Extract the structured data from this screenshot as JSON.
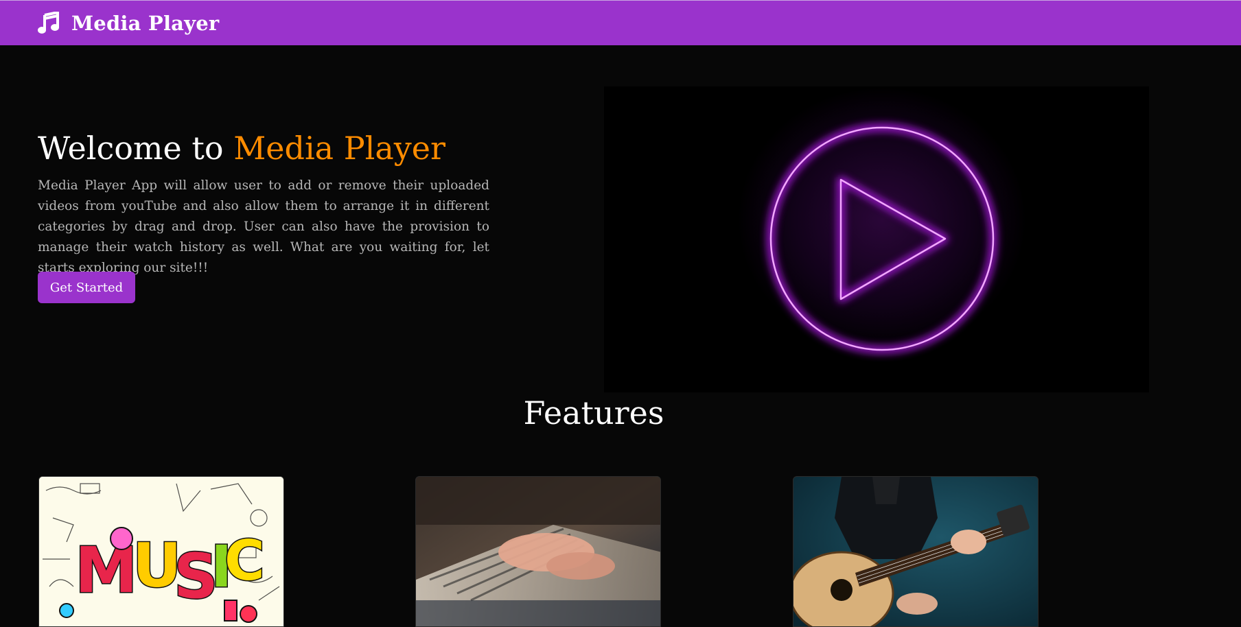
{
  "navbar": {
    "brand": "Media Player",
    "icon": "music-note-icon",
    "color": "#9a33cc"
  },
  "hero": {
    "title_prefix": "Welcome to ",
    "title_accent": "Media Player",
    "accent_color": "#ff8c00",
    "description": "Media Player App will allow user to add or remove their uploaded videos from youTube and also allow them to arrange it in different categories by drag and drop. User can also have the provision to manage their watch history as well. What are you waiting for, let starts exploring our site!!!",
    "cta_label": "Get Started"
  },
  "hero_media": {
    "icon": "neon-play-icon",
    "glow_color": "#d233ff"
  },
  "features": {
    "title": "Features",
    "cards": [
      {
        "image": "music-doodle-image",
        "art_text": "MUSIC"
      },
      {
        "image": "piano-hands-image"
      },
      {
        "image": "acoustic-guitar-image"
      }
    ]
  }
}
